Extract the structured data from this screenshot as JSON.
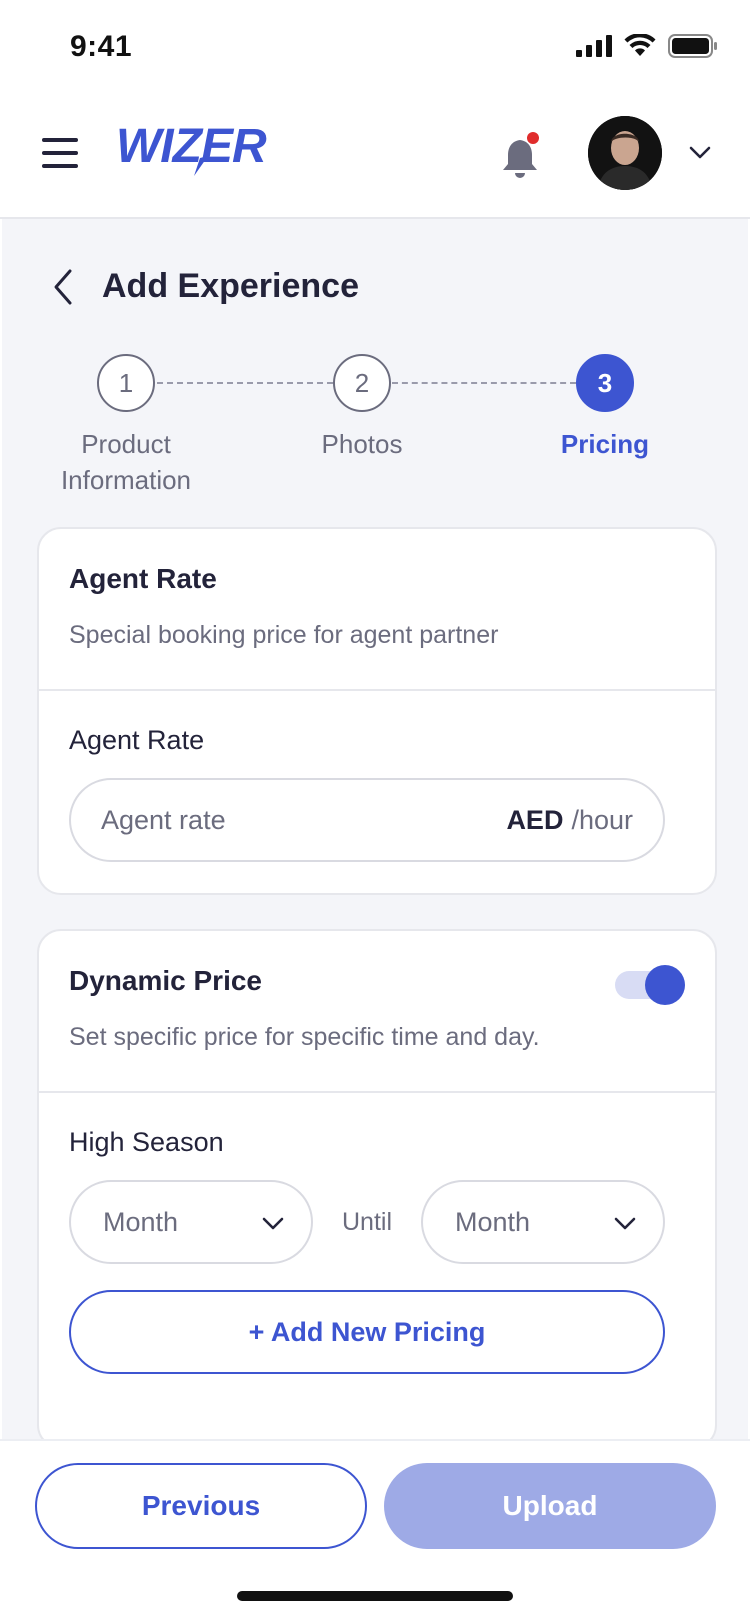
{
  "status_bar": {
    "time": "9:41"
  },
  "header": {
    "logo_text": "WIZER",
    "brand_color": "#3d55d1",
    "notification_dot_color": "#e02c2c",
    "icons": [
      "menu-icon",
      "bell-icon",
      "chevron-down-icon"
    ]
  },
  "page": {
    "title": "Add Experience",
    "back_icon": "chevron-left-icon"
  },
  "stepper": {
    "steps": [
      {
        "number": "1",
        "label_line1": "Product",
        "label_line2": "Information",
        "state": "done"
      },
      {
        "number": "2",
        "label_line1": "Photos",
        "label_line2": "",
        "state": "done"
      },
      {
        "number": "3",
        "label_line1": "Pricing",
        "label_line2": "",
        "state": "active"
      }
    ]
  },
  "agent_rate_card": {
    "title": "Agent Rate",
    "description": "Special booking price for agent partner",
    "field_label": "Agent Rate",
    "input_placeholder": "Agent rate",
    "currency": "AED",
    "unit": "/hour"
  },
  "dynamic_price_card": {
    "title": "Dynamic Price",
    "description": "Set specific price for specific time and day.",
    "toggle_on": true,
    "season_label": "High Season",
    "from_select": "Month",
    "until_label": "Until",
    "to_select": "Month",
    "add_button": "+ Add New Pricing"
  },
  "footer": {
    "previous_label": "Previous",
    "upload_label": "Upload"
  }
}
